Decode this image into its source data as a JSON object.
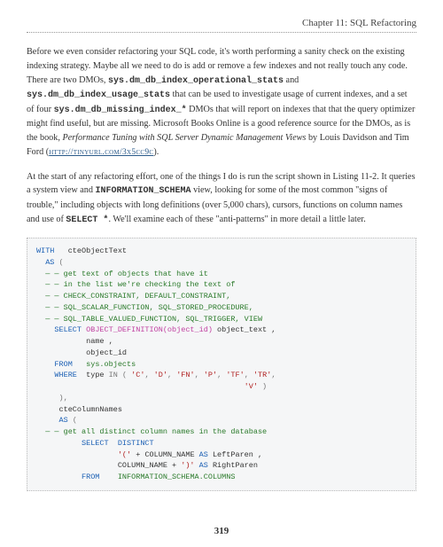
{
  "header": {
    "chapter": "Chapter 11: SQL Refactoring"
  },
  "p1": {
    "t1": "Before we even consider refactoring your SQL code, it's worth performing a sanity check on the existing indexing strategy. Maybe all we need to do is add or remove a few indexes and not really touch any code. There are two DMOs, ",
    "c1": "sys.dm_db_index_operational_stats",
    "t2": " and ",
    "c2": "sys.dm_db_index_usage_stats",
    "t3": " that can be used to investigate usage of current indexes, and a set of four ",
    "c3": "sys.dm_db_missing_index_*",
    "t4": " DMOs that will report on indexes that that the query optimizer might find useful, but are missing. Microsoft Books Online is a good reference source for the DMOs, as is the book, ",
    "i1": "Performance Tuning with SQL Server Dynamic Management Views",
    "t5": " by Louis Davidson and Tim Ford (",
    "link": "http://tinyurl.com/3x5cc9c",
    "t6": ")."
  },
  "p2": {
    "t1": "At the start of any refactoring effort, one of the things I do is run the script shown in Listing 11-2. It queries a system view and ",
    "c1": "INFORMATION_SCHEMA",
    "t2": " view, looking for some of the most common \"signs of trouble,\" including objects with long definitions (over 5,000 chars), cursors, functions on column names and use of ",
    "c2": "SELECT *",
    "t3": ". We'll examine each of these \"anti-patterns\" in more detail a little later."
  },
  "code": {
    "l1a": "WITH",
    "l1b": "   cteObjectText",
    "l2a": "  AS",
    "l2b": " (",
    "l3": "  — — get text of objects that have it",
    "l4": "  — — in the list we're checking the text of",
    "l5": "  — — CHECK_CONSTRAINT, DEFAULT_CONSTRAINT,",
    "l6": "  — — SQL_SCALAR_FUNCTION, SQL_STORED_PROCEDURE,",
    "l7": "  — — SQL_TABLE_VALUED_FUNCTION, SQL_TRIGGER, VIEW",
    "l8a": "    SELECT",
    "l8b": " OBJECT_DEFINITION(object_id)",
    "l8c": " object_text ,",
    "l9": "           name ,",
    "l10": "           object_id",
    "l11a": "    FROM",
    "l11b": "   sys.objects",
    "l12a": "    WHERE",
    "l12b": "  type ",
    "l12c": "IN",
    "l12d": " ( ",
    "l12e": "'C'",
    "l12f": ", ",
    "l12g": "'D'",
    "l12h": ", ",
    "l12i": "'FN'",
    "l12j": ", ",
    "l12k": "'P'",
    "l12l": ", ",
    "l12m": "'TF'",
    "l12n": ", ",
    "l12o": "'TR'",
    "l12p": ",",
    "l13a": "                                              ",
    "l13b": "'V'",
    "l13c": " )",
    "l14": "     ),",
    "l15": "     cteColumnNames",
    "l16a": "     AS",
    "l16b": " (",
    "l17": "  — — get all distinct column names in the database",
    "l18a": "          SELECT",
    "l18b": "  DISTINCT",
    "l19a": "                  ",
    "l19b": "'('",
    "l19c": " + COLUMN_NAME ",
    "l19d": "AS",
    "l19e": " LeftParen ,",
    "l20a": "                  COLUMN_NAME + ",
    "l20b": "')'",
    "l20c": " AS",
    "l20d": " RightParen",
    "l21a": "          FROM",
    "l21b": "    INFORMATION_SCHEMA.COLUMNS"
  },
  "page": "319"
}
